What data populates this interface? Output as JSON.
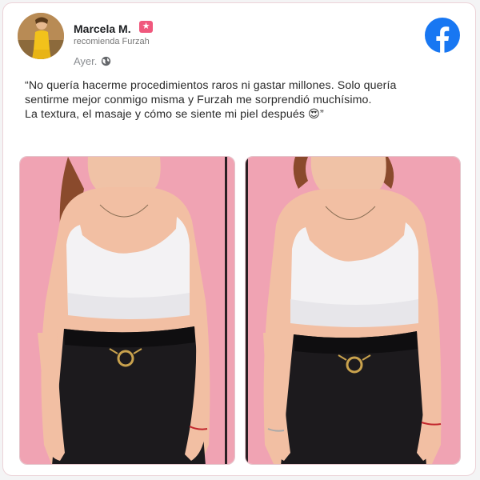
{
  "post": {
    "author_name": "Marcela M.",
    "badge_icon": "star-badge-icon",
    "recommends": "recomienda Furzah",
    "time": "Ayer.",
    "privacy_icon": "globe-icon",
    "platform_icon": "facebook-logo-icon",
    "quote_line1": "“No quería hacerme procedimientos raros ni gastar millones. Solo quería",
    "quote_line2": "sentirme mejor conmigo misma y Furzah me sorprendió muchísimo.",
    "quote_line3": "La textura, el masaje y cómo se siente mi piel después 😍”"
  },
  "colors": {
    "facebook_blue": "#1877f2",
    "badge_pink": "#f0587d",
    "photo_background_pink": "#f0a3b3"
  },
  "photos": [
    {
      "label": "before-photo"
    },
    {
      "label": "after-photo"
    }
  ]
}
